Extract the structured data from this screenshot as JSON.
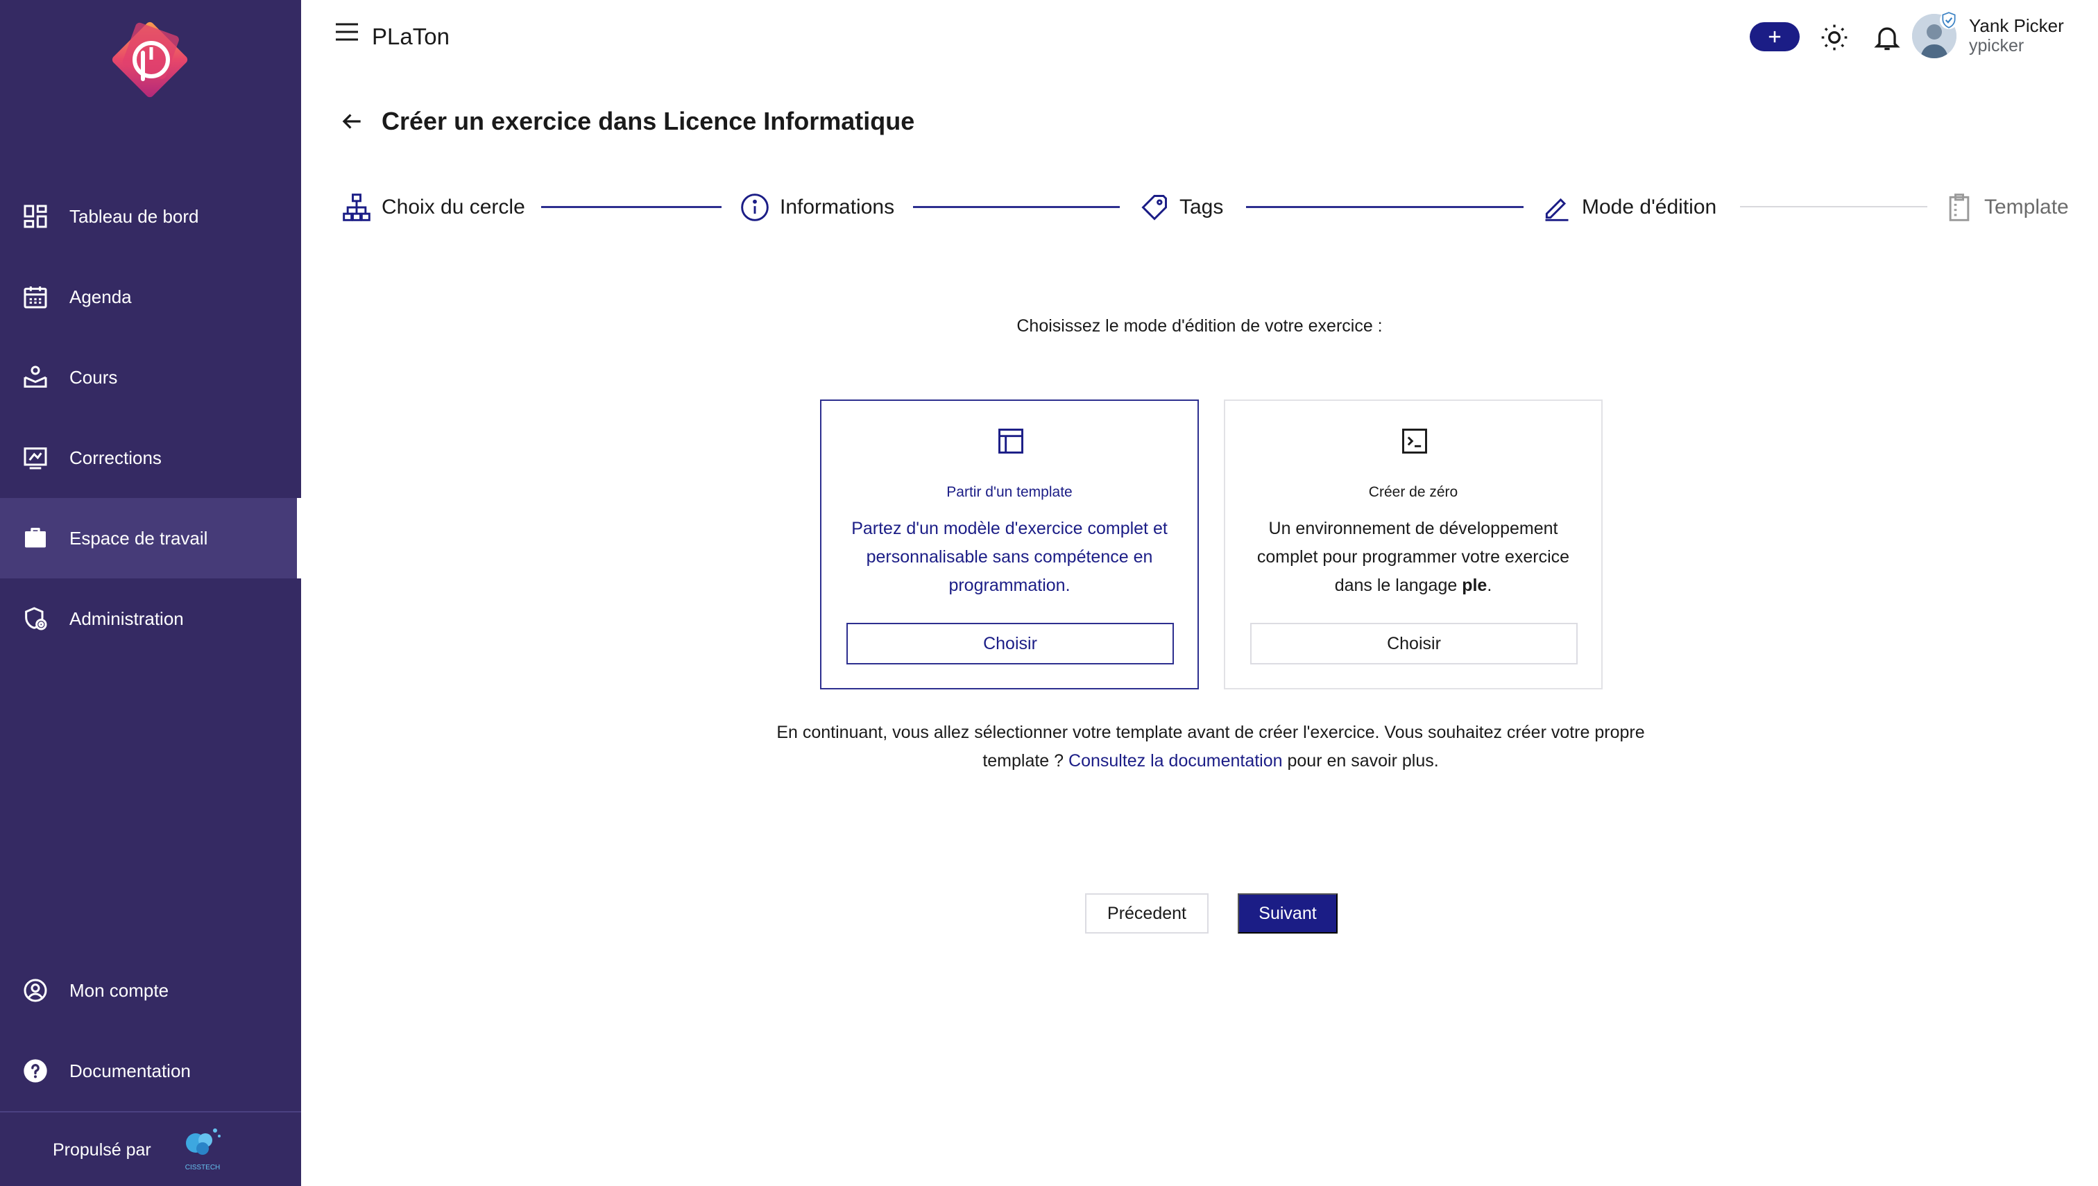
{
  "app": {
    "title": "PLaTon"
  },
  "sidebar": {
    "items": [
      {
        "label": "Tableau de bord",
        "icon": "dashboard-icon"
      },
      {
        "label": "Agenda",
        "icon": "calendar-icon"
      },
      {
        "label": "Cours",
        "icon": "course-icon"
      },
      {
        "label": "Corrections",
        "icon": "corrections-icon"
      },
      {
        "label": "Espace de travail",
        "icon": "briefcase-icon",
        "active": true
      },
      {
        "label": "Administration",
        "icon": "admin-icon"
      }
    ],
    "bottom_items": [
      {
        "label": "Mon compte",
        "icon": "account-icon"
      },
      {
        "label": "Documentation",
        "icon": "help-icon"
      }
    ],
    "powered_by": "Propulsé par",
    "powered_brand": "CISSTECH"
  },
  "user": {
    "name": "Yank Picker",
    "handle": "ypicker"
  },
  "header": {
    "title": "Créer un exercice dans Licence Informatique"
  },
  "stepper": {
    "steps": [
      {
        "label": "Choix du cercle",
        "icon": "hierarchy-icon",
        "state": "done"
      },
      {
        "label": "Informations",
        "icon": "info-icon",
        "state": "done"
      },
      {
        "label": "Tags",
        "icon": "tag-icon",
        "state": "done"
      },
      {
        "label": "Mode d'édition",
        "icon": "edit-icon",
        "state": "current"
      },
      {
        "label": "Template",
        "icon": "clipboard-icon",
        "state": "disabled"
      }
    ]
  },
  "content": {
    "prompt": "Choisissez le mode d'édition de votre exercice :",
    "cards": [
      {
        "icon": "template-icon",
        "title": "Partir d'un template",
        "description": "Partez d'un modèle d'exercice complet et personnalisable sans compétence en programmation.",
        "button": "Choisir",
        "selected": true
      },
      {
        "icon": "terminal-icon",
        "title": "Créer de zéro",
        "description_pre": "Un environnement de développement complet pour programmer votre exercice dans le langage ",
        "description_bold": "ple",
        "description_post": ".",
        "button": "Choisir",
        "selected": false
      }
    ],
    "info_pre": "En continuant, vous allez sélectionner votre template avant de créer l'exercice. Vous souhaitez créer votre propre template ? ",
    "info_link": "Consultez la documentation",
    "info_post": " pour en savoir plus."
  },
  "actions": {
    "previous": "Précedent",
    "next": "Suivant"
  },
  "colors": {
    "sidebar": "#352a63",
    "sidebar_active": "#463b78",
    "primary": "#1b1d86"
  }
}
